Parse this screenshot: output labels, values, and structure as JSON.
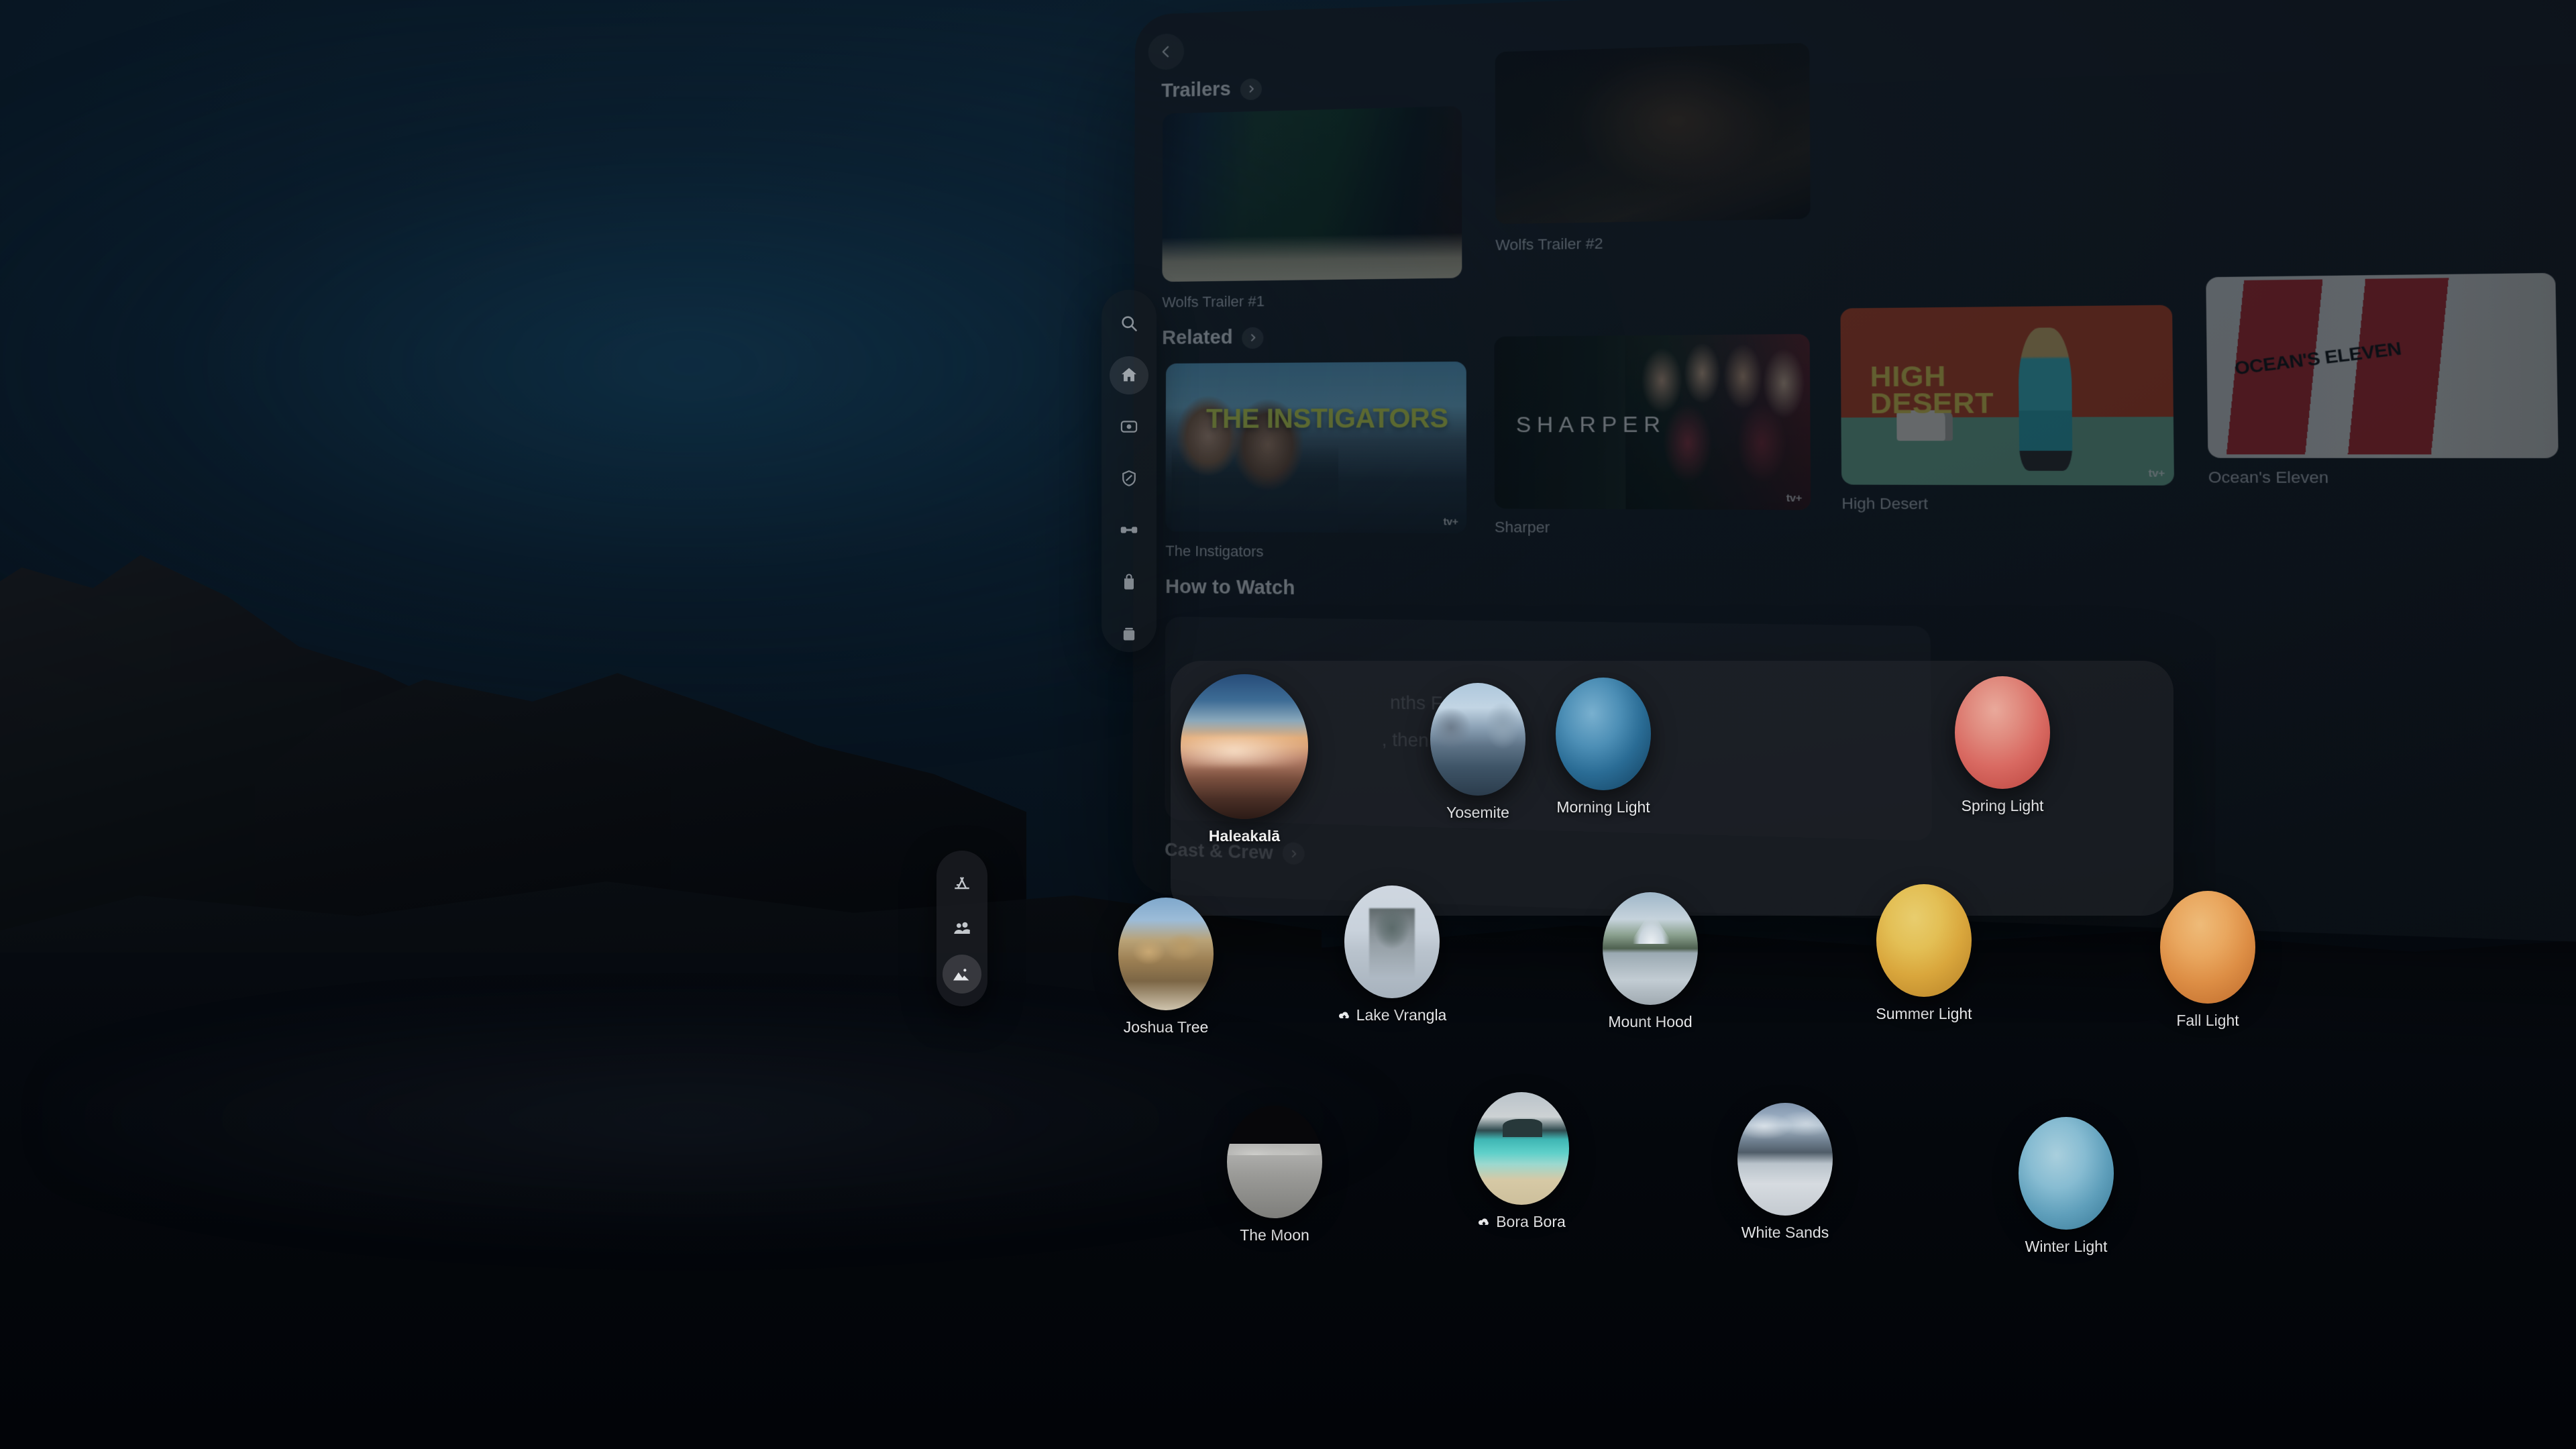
{
  "environment": {
    "name": "Joshua Tree",
    "time_of_day": "night"
  },
  "tv_app": {
    "back_label": "Back",
    "sections": [
      {
        "id": "trailers",
        "title": "Trailers"
      },
      {
        "id": "related",
        "title": "Related"
      },
      {
        "id": "how_to_watch",
        "title": "How to Watch"
      },
      {
        "id": "cast_crew",
        "title": "Cast & Crew"
      }
    ],
    "trailers": [
      {
        "title": "Wolfs Trailer #1"
      },
      {
        "title": "Wolfs Trailer #2"
      }
    ],
    "related": [
      {
        "title": "The Instigators",
        "art_title": "THE INSTIGATORS",
        "badge": "tv+"
      },
      {
        "title": "Sharper",
        "art_title": "SHARPER",
        "badge": "tv+"
      },
      {
        "title": "High Desert",
        "art_title_line1": "HIGH",
        "art_title_line2": "DESERT",
        "badge": "tv+"
      },
      {
        "title": "Ocean's Eleven",
        "art_title": "OCEAN'S ELEVEN",
        "badge": ""
      }
    ],
    "subscription_offer": {
      "line1": "nths Free",
      "line2": ", then $9."
    },
    "sidebar": [
      {
        "id": "search",
        "icon": "search-icon",
        "label": "Search",
        "active": false
      },
      {
        "id": "home",
        "icon": "home-icon",
        "label": "Home",
        "active": true
      },
      {
        "id": "store",
        "icon": "movie-icon",
        "label": "Store",
        "active": false
      },
      {
        "id": "tvplus",
        "icon": "shield-icon",
        "label": "Apple TV+",
        "active": false
      },
      {
        "id": "sports",
        "icon": "sports-icon",
        "label": "Sports",
        "active": false
      },
      {
        "id": "shop",
        "icon": "bag-icon",
        "label": "Shop",
        "active": false
      },
      {
        "id": "library",
        "icon": "library-icon",
        "label": "Library",
        "active": false
      }
    ]
  },
  "environments_picker": {
    "selected": "Haleakalā",
    "items": [
      {
        "name": "Haleakalā",
        "kind": "scene",
        "selected": true,
        "downloadable": false,
        "art": "t-haleakala",
        "size": "big"
      },
      {
        "name": "Yosemite",
        "kind": "scene",
        "selected": false,
        "downloadable": false,
        "art": "t-yosemite",
        "size": "std"
      },
      {
        "name": "Morning Light",
        "kind": "light",
        "selected": false,
        "downloadable": false,
        "art": "t-morning",
        "size": "std",
        "color": "#4d8fb6"
      },
      {
        "name": "Spring Light",
        "kind": "light",
        "selected": false,
        "downloadable": false,
        "art": "t-spring",
        "size": "std",
        "color": "#e08a7e"
      },
      {
        "name": "Joshua Tree",
        "kind": "scene",
        "selected": false,
        "downloadable": false,
        "art": "t-joshua",
        "size": "std"
      },
      {
        "name": "Lake Vrangla",
        "kind": "scene",
        "selected": false,
        "downloadable": true,
        "art": "t-vrangla",
        "size": "std"
      },
      {
        "name": "Mount Hood",
        "kind": "scene",
        "selected": false,
        "downloadable": false,
        "art": "t-hood",
        "size": "std"
      },
      {
        "name": "Summer Light",
        "kind": "light",
        "selected": false,
        "downloadable": false,
        "art": "t-summer",
        "size": "std",
        "color": "#e3bf55"
      },
      {
        "name": "Fall Light",
        "kind": "light",
        "selected": false,
        "downloadable": false,
        "art": "t-fall",
        "size": "std",
        "color": "#e9a75f"
      },
      {
        "name": "The Moon",
        "kind": "scene",
        "selected": false,
        "downloadable": false,
        "art": "t-moon",
        "size": "std"
      },
      {
        "name": "Bora Bora",
        "kind": "scene",
        "selected": false,
        "downloadable": true,
        "art": "t-bora",
        "size": "std"
      },
      {
        "name": "White Sands",
        "kind": "scene",
        "selected": false,
        "downloadable": false,
        "art": "t-whitesands",
        "size": "std"
      },
      {
        "name": "Winter Light",
        "kind": "light",
        "selected": false,
        "downloadable": false,
        "art": "t-winter",
        "size": "std",
        "color": "#87bcd2"
      }
    ]
  },
  "home_ornament": {
    "items": [
      {
        "id": "apps",
        "icon": "app-library-icon",
        "label": "Apps",
        "active": false
      },
      {
        "id": "people",
        "icon": "people-icon",
        "label": "People",
        "active": false
      },
      {
        "id": "environments",
        "icon": "environments-icon",
        "label": "Environments",
        "active": true
      }
    ]
  }
}
